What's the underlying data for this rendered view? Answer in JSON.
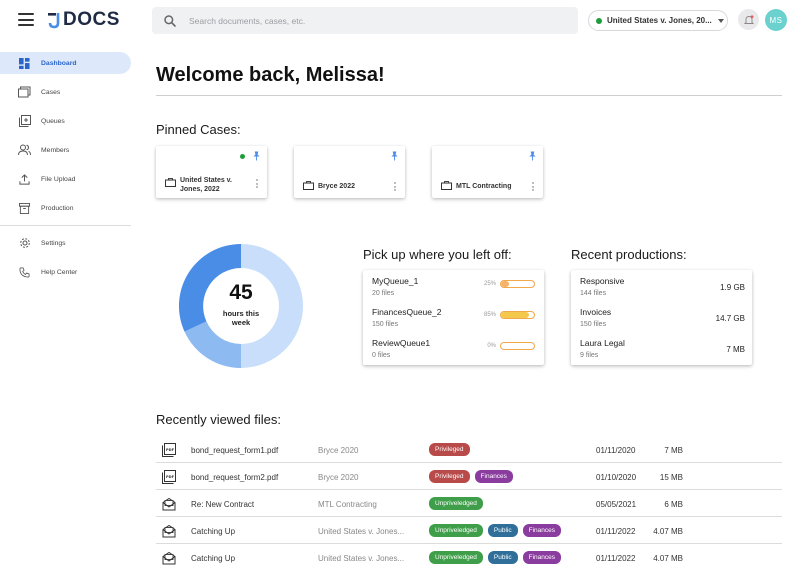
{
  "app": {
    "logo_text": "DOCS"
  },
  "search": {
    "placeholder": "Search documents, cases, etc."
  },
  "case_selector": {
    "label": "United States v. Jones, 20..."
  },
  "user": {
    "initials": "MS"
  },
  "sidebar": {
    "items": [
      {
        "label": "Dashboard",
        "icon": "dashboard-icon",
        "active": true
      },
      {
        "label": "Cases",
        "icon": "cases-icon"
      },
      {
        "label": "Queues",
        "icon": "queues-icon"
      },
      {
        "label": "Members",
        "icon": "members-icon"
      },
      {
        "label": "File Upload",
        "icon": "upload-icon"
      },
      {
        "label": "Production",
        "icon": "production-icon"
      },
      {
        "label": "Settings",
        "icon": "gear-icon"
      },
      {
        "label": "Help Center",
        "icon": "phone-icon"
      }
    ]
  },
  "main": {
    "welcome": "Welcome back, Melissa!",
    "pinned_title": "Pinned Cases:",
    "pinned_cases": [
      {
        "title": "United States v. Jones, 2022",
        "active": true
      },
      {
        "title": "Bryce 2022",
        "active": false
      },
      {
        "title": "MTL Contracting",
        "active": false
      }
    ],
    "hours": {
      "value": "45",
      "label": "hours this week"
    },
    "pickup_title": "Pick up where you left off:",
    "queues": [
      {
        "name": "MyQueue_1",
        "files": "20 files",
        "percent_label": "25%",
        "percent": 25,
        "color": "#f5b36a"
      },
      {
        "name": "FinancesQueue_2",
        "files": "150 files",
        "percent_label": "85%",
        "percent": 85,
        "color": "#f3c84b"
      },
      {
        "name": "ReviewQueue1",
        "files": "0 files",
        "percent_label": "0%",
        "percent": 0,
        "color": "#f5b36a"
      }
    ],
    "productions_title": "Recent productions:",
    "productions": [
      {
        "name": "Responsive",
        "files": "144 files",
        "size": "1.9 GB"
      },
      {
        "name": "Invoices",
        "files": "150 files",
        "size": "14.7 GB"
      },
      {
        "name": "Laura Legal",
        "files": "9 files",
        "size": "7 MB"
      }
    ],
    "recent_title": "Recently viewed files:",
    "files": [
      {
        "icon": "pdf-icon",
        "name": "bond_request_form1.pdf",
        "case": "Bryce 2020",
        "tags": [
          {
            "label": "Privileged",
            "color": "#b84a4a"
          }
        ],
        "date": "01/11/2020",
        "size": "7 MB"
      },
      {
        "icon": "pdf-icon",
        "name": "bond_request_form2.pdf",
        "case": "Bryce 2020",
        "tags": [
          {
            "label": "Privileged",
            "color": "#b84a4a"
          },
          {
            "label": "Finances",
            "color": "#8a3d9e"
          }
        ],
        "date": "01/10/2020",
        "size": "15 MB"
      },
      {
        "icon": "email-icon",
        "name": "Re: New Contract",
        "case": "MTL Contracting",
        "tags": [
          {
            "label": "Unpriveledged",
            "color": "#3f9e4a"
          }
        ],
        "date": "05/05/2021",
        "size": "6 MB"
      },
      {
        "icon": "email-icon",
        "name": "Catching Up",
        "case": "United States v. Jones...",
        "tags": [
          {
            "label": "Unpriveledged",
            "color": "#3f9e4a"
          },
          {
            "label": "Public",
            "color": "#2f6f9a"
          },
          {
            "label": "Finances",
            "color": "#8a3d9e"
          }
        ],
        "date": "01/11/2022",
        "size": "4.07 MB"
      },
      {
        "icon": "email-icon",
        "name": "Catching Up",
        "case": "United States v. Jones...",
        "tags": [
          {
            "label": "Unpriveledged",
            "color": "#3f9e4a"
          },
          {
            "label": "Public",
            "color": "#2f6f9a"
          },
          {
            "label": "Finances",
            "color": "#8a3d9e"
          }
        ],
        "date": "01/11/2022",
        "size": "4.07 MB"
      }
    ]
  },
  "colors": {
    "accent": "#2b65c8",
    "donut_dark": "#4a8de6",
    "donut_mid": "#8cbaf1",
    "donut_light": "#c8defa"
  }
}
